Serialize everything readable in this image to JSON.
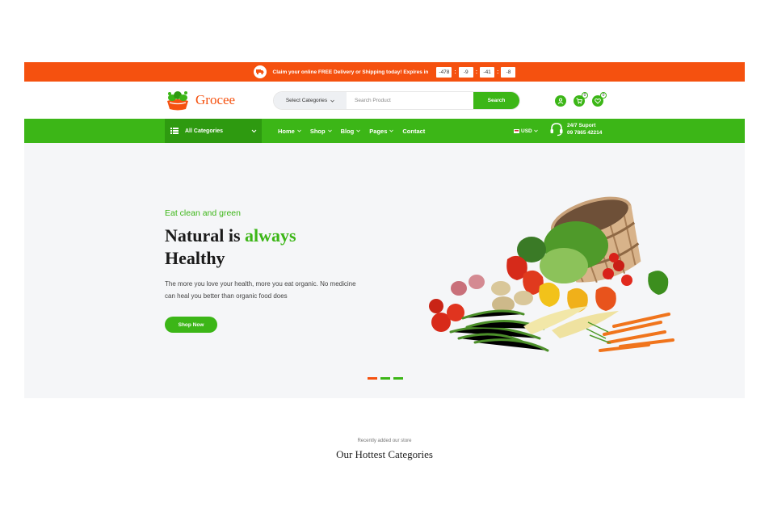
{
  "promo": {
    "message": "Claim your online FREE Delivery or Shipping today! Expires in",
    "countdown": [
      "-478",
      "-9",
      "-41",
      "-8"
    ],
    "icon": "truck-icon"
  },
  "header": {
    "logo_text": "Grocee",
    "search": {
      "category_label": "Select Categories",
      "placeholder": "Search Product",
      "button_label": "Search"
    },
    "cart_count": "0",
    "wishlist_count": "0"
  },
  "nav": {
    "all_categories": "All Categories",
    "menu": [
      "Home",
      "Shop",
      "Blog",
      "Pages",
      "Contact"
    ],
    "currency": "USD",
    "support_label": "24/7 Suport",
    "support_phone": "09 7865 42214"
  },
  "hero": {
    "eyebrow": "Eat clean and green",
    "headline_part1": "Natural is ",
    "headline_highlight": "always",
    "headline_part2": "Healthy",
    "description": "The more you love your health, more you eat organic. No medicine can heal you better than organic food does",
    "cta_label": "Shop Now",
    "slides": 3,
    "active_slide": 1
  },
  "section": {
    "subtitle": "Recently added our store",
    "title": "Our Hottest Categories"
  },
  "colors": {
    "primary_green": "#3cb617",
    "accent_orange": "#f5510f",
    "hero_bg": "#f5f6f8"
  }
}
